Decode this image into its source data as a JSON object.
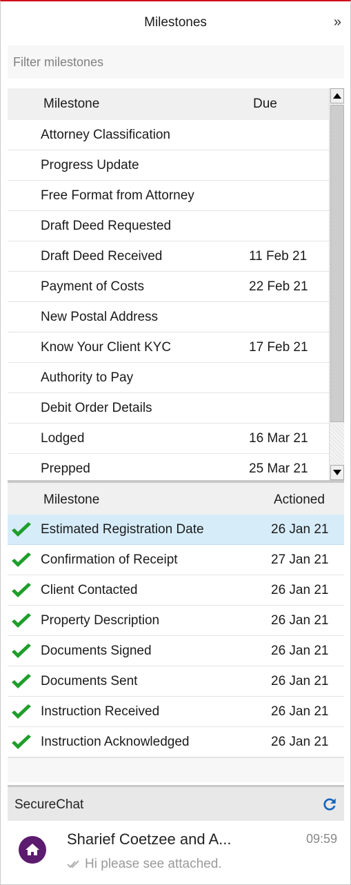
{
  "header": {
    "title": "Milestones",
    "collapse_glyph": "»"
  },
  "filter": {
    "placeholder": "Filter milestones",
    "value": ""
  },
  "upcoming": {
    "columns": {
      "milestone": "Milestone",
      "due": "Due"
    },
    "rows": [
      {
        "name": "Attorney Classification",
        "due": ""
      },
      {
        "name": "Progress Update",
        "due": ""
      },
      {
        "name": "Free Format from Attorney",
        "due": ""
      },
      {
        "name": "Draft Deed Requested",
        "due": ""
      },
      {
        "name": "Draft Deed Received",
        "due": "11 Feb 21"
      },
      {
        "name": "Payment of Costs",
        "due": "22 Feb 21"
      },
      {
        "name": "New Postal Address",
        "due": ""
      },
      {
        "name": "Know Your Client KYC",
        "due": "17 Feb 21"
      },
      {
        "name": "Authority to Pay",
        "due": ""
      },
      {
        "name": "Debit Order Details",
        "due": ""
      },
      {
        "name": "Lodged",
        "due": "16 Mar 21"
      },
      {
        "name": "Prepped",
        "due": "25 Mar 21"
      }
    ]
  },
  "completed": {
    "columns": {
      "milestone": "Milestone",
      "actioned": "Actioned"
    },
    "rows": [
      {
        "name": "Estimated Registration Date",
        "actioned": "26 Jan 21",
        "selected": true
      },
      {
        "name": "Confirmation of Receipt",
        "actioned": "27 Jan 21"
      },
      {
        "name": "Client Contacted",
        "actioned": "26 Jan 21"
      },
      {
        "name": "Property Description",
        "actioned": "26 Jan 21"
      },
      {
        "name": "Documents Signed",
        "actioned": "26 Jan 21"
      },
      {
        "name": "Documents Sent",
        "actioned": "26 Jan 21"
      },
      {
        "name": "Instruction Received",
        "actioned": "26 Jan 21"
      },
      {
        "name": "Instruction Acknowledged",
        "actioned": "26 Jan 21"
      }
    ]
  },
  "chat": {
    "title": "SecureChat",
    "conversations": [
      {
        "name": "Sharief Coetzee and A...",
        "time": "09:59",
        "preview": "Hi  please see attached."
      }
    ]
  },
  "colors": {
    "accent_top": "#d0021b",
    "check_green": "#1e9e2a",
    "selected_row": "#d6ecf9",
    "refresh_blue": "#1565c0",
    "avatar_purple": "#5b1b6e"
  },
  "icons": {
    "check": "check-icon",
    "refresh": "refresh-icon",
    "home": "home-icon",
    "read_receipt": "double-check-icon",
    "collapse": "double-chevron-right-icon"
  }
}
